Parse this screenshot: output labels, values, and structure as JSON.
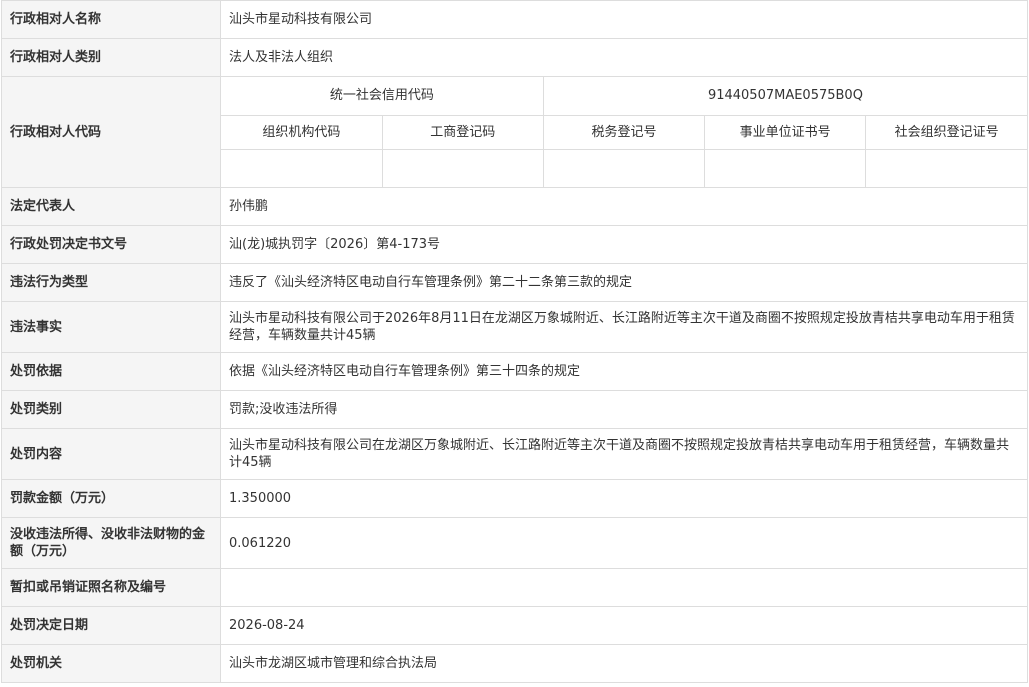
{
  "rows": {
    "name": {
      "label": "行政相对人名称",
      "value": "汕头市星动科技有限公司"
    },
    "category": {
      "label": "行政相对人类别",
      "value": "法人及非法人组织"
    },
    "code": {
      "label": "行政相对人代码",
      "credit_code_label": "统一社会信用代码",
      "credit_code_value": "91440507MAE0575B0Q",
      "sub_labels": [
        "组织机构代码",
        "工商登记码",
        "税务登记号",
        "事业单位证书号",
        "社会组织登记证号"
      ],
      "sub_values": [
        "",
        "",
        "",
        "",
        ""
      ]
    },
    "legal_rep": {
      "label": "法定代表人",
      "value": "孙伟鹏"
    },
    "doc_no": {
      "label": "行政处罚决定书文号",
      "value": "汕(龙)城执罚字〔2026〕第4-173号"
    },
    "violation_type": {
      "label": "违法行为类型",
      "value": "违反了《汕头经济特区电动自行车管理条例》第二十二条第三款的规定"
    },
    "violation_facts": {
      "label": "违法事实",
      "value": "汕头市星动科技有限公司于2026年8月11日在龙湖区万象城附近、长江路附近等主次干道及商圈不按照规定投放青桔共享电动车用于租赁经营，车辆数量共计45辆"
    },
    "basis": {
      "label": "处罚依据",
      "value": "依据《汕头经济特区电动自行车管理条例》第三十四条的规定"
    },
    "penalty_type": {
      "label": "处罚类别",
      "value": "罚款;没收违法所得"
    },
    "penalty_content": {
      "label": "处罚内容",
      "value": "汕头市星动科技有限公司在龙湖区万象城附近、长江路附近等主次干道及商圈不按照规定投放青桔共享电动车用于租赁经营，车辆数量共计45辆"
    },
    "fine": {
      "label": "罚款金额（万元）",
      "value": "1.350000"
    },
    "confiscation": {
      "label": "没收违法所得、没收非法财物的金额（万元）",
      "value": "0.061220"
    },
    "license": {
      "label": "暂扣或吊销证照名称及编号",
      "value": ""
    },
    "date": {
      "label": "处罚决定日期",
      "value": "2026-08-24"
    },
    "authority": {
      "label": "处罚机关",
      "value": "汕头市龙湖区城市管理和综合执法局"
    }
  }
}
